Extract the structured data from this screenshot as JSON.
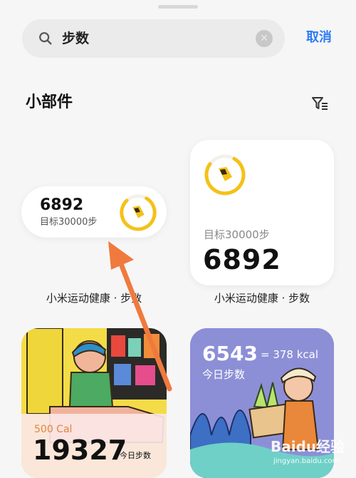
{
  "search": {
    "query": "步数",
    "cancel_label": "取消"
  },
  "section": {
    "title": "小部件"
  },
  "widgets": [
    {
      "steps": "6892",
      "goal": "目标30000步",
      "caption": "小米运动健康 · 步数"
    },
    {
      "steps": "6892",
      "goal": "目标30000步",
      "caption": "小米运动健康 · 步数"
    }
  ],
  "art_widgets": [
    {
      "calories": "500 Cal",
      "steps": "19327",
      "today_label": "今日步数"
    },
    {
      "steps": "6543",
      "kcal": "= 378 kcal",
      "today_label": "今日步数"
    }
  ],
  "colors": {
    "accent": "#2b7cf6",
    "ring": "#f5c118"
  },
  "icons": [
    "search-icon",
    "clear-icon",
    "filter-icon",
    "shoe-icon"
  ],
  "watermark": {
    "logo": "Baidu经验",
    "url": "jingyan.baidu.com"
  }
}
